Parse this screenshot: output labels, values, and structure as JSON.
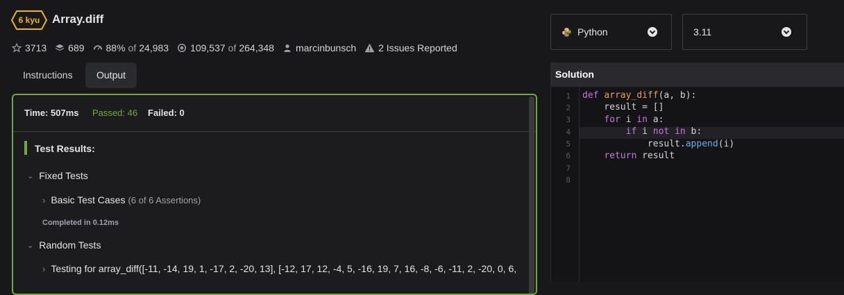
{
  "kata": {
    "rank": "6 kyu",
    "title": "Array.diff",
    "stats": {
      "stars": "3713",
      "collections": "689",
      "satisfaction": "88%",
      "satisfaction_of": "of",
      "votes": "24,983",
      "completed": "109,537",
      "completed_of": "of",
      "attempts": "264,348",
      "author": "marcinbunsch",
      "issues": "2 Issues Reported"
    }
  },
  "tabs": [
    {
      "label": "Instructions",
      "active": false
    },
    {
      "label": "Output",
      "active": true
    }
  ],
  "output": {
    "time": "Time: 507ms",
    "passed": "Passed: 46",
    "failed": "Failed: 0",
    "results_title": "Test Results:",
    "fixed_tests": "Fixed Tests",
    "basic_cases": "Basic Test Cases",
    "basic_assertions": "(6 of 6 Assertions)",
    "completed_in": "Completed in 0.12ms",
    "random_tests": "Random Tests",
    "testing_for": "Testing for array_diff([-11, -14, 19, 1, -17, 2, -20, 13], [-12, 17, 12, -4, 5, -16, 19, 7, 16, -8, -6, -11, 2, -20, 0, 6,"
  },
  "language": {
    "selected": "Python",
    "version": "3.11"
  },
  "solution": {
    "header": "Solution",
    "line_numbers": [
      "1",
      "2",
      "3",
      "4",
      "5",
      "6",
      "7",
      "8"
    ]
  },
  "colors": {
    "accent_green": "#6fab3b",
    "rank_yellow": "#ecb613"
  }
}
